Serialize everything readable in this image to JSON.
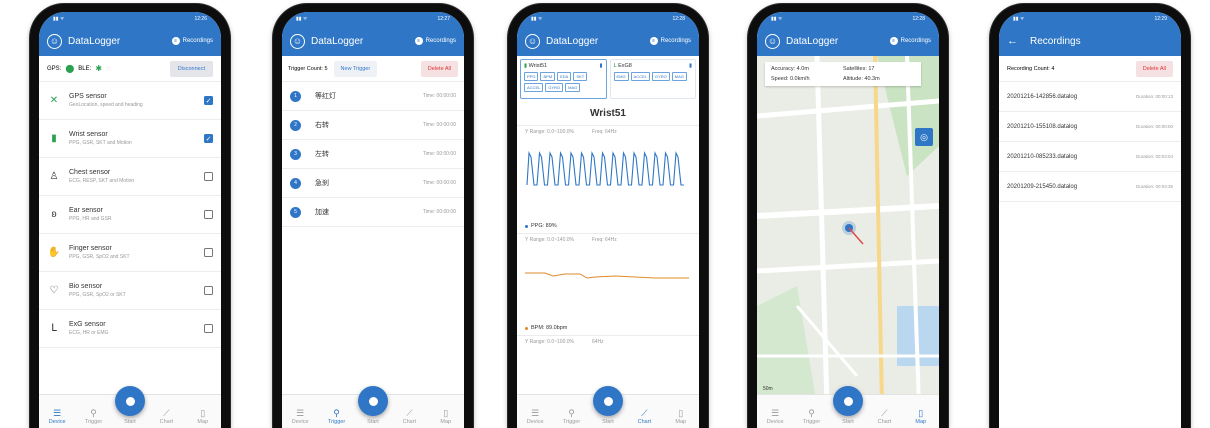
{
  "app": {
    "title": "DataLogger",
    "recordings_label": "Recordings"
  },
  "status": {
    "times": [
      "12:26",
      "12:27",
      "12:28",
      "12:28",
      "12:29"
    ]
  },
  "nav": {
    "device": "Device",
    "trigger": "Trigger",
    "start": "Start",
    "chart": "Chart",
    "map": "Map"
  },
  "device_screen": {
    "gps_label": "GPS:",
    "ble_label": "BLE:",
    "disconnect": "Disconnect",
    "sensors": [
      {
        "name": "GPS sensor",
        "desc": "GeoLocation, speed and heading",
        "checked": true,
        "icon": "satellite-icon"
      },
      {
        "name": "Wrist sensor",
        "desc": "PPG, GSR, SKT and Motion",
        "checked": true,
        "icon": "watch-icon"
      },
      {
        "name": "Chest sensor",
        "desc": "ECG, RESP, SKT and Motion",
        "checked": false,
        "icon": "chest-icon"
      },
      {
        "name": "Ear sensor",
        "desc": "PPG, HR and GSR",
        "checked": false,
        "icon": "ear-icon"
      },
      {
        "name": "Finger sensor",
        "desc": "PPG, GSR, SpO2 and SKT",
        "checked": false,
        "icon": "hand-icon"
      },
      {
        "name": "Bio sensor",
        "desc": "PPG, GSR, SpO2 or SKT",
        "checked": false,
        "icon": "heart-icon"
      },
      {
        "name": "ExG sensor",
        "desc": "ECG, HR or EMG",
        "checked": false,
        "icon": "muscle-icon"
      }
    ]
  },
  "trigger_screen": {
    "count_label": "Trigger Count: 5",
    "new_trigger": "New Trigger",
    "delete_all": "Delete All",
    "triggers": [
      {
        "num": "1",
        "name": "等红灯",
        "time": "Time: 00:00:00"
      },
      {
        "num": "2",
        "name": "右转",
        "time": "Time: 00:00:00"
      },
      {
        "num": "3",
        "name": "左转",
        "time": "Time: 00:00:00"
      },
      {
        "num": "4",
        "name": "急刹",
        "time": "Time: 00:00:00"
      },
      {
        "num": "5",
        "name": "加速",
        "time": "Time: 00:00:00"
      }
    ]
  },
  "chart_screen": {
    "devices": [
      {
        "name": "Wrist51",
        "chips": [
          "PPG",
          "BPM",
          "EDA",
          "SKT",
          "ACCEL",
          "GYRO",
          "MAG"
        ]
      },
      {
        "name": "ExG8",
        "chips": [
          "EMG",
          "ACCEL",
          "GYRO",
          "MAG"
        ]
      }
    ],
    "device_title": "Wrist51",
    "plot1": {
      "range": "Y Range:  0.0~100.0%",
      "freq": "Freq:  64Hz",
      "label": "PPG: 89%"
    },
    "plot2": {
      "range": "Y Range:  0.0~140.0%",
      "freq": "Freq:  64Hz",
      "label": "BPM: 89.0bpm"
    },
    "plot3": {
      "range": "Y Range:  0.0~100.0%",
      "freq": "64Hz"
    }
  },
  "map_screen": {
    "accuracy": "Accuracy: 4.0m",
    "satellites": "Satellites: 17",
    "speed": "Speed: 0.0km/h",
    "altitude": "Altitude: 40.3m",
    "scale": "50m"
  },
  "recordings_screen": {
    "title": "Recordings",
    "count_label": "Recording Count: 4",
    "delete_all": "Delete All",
    "items": [
      {
        "name": "20201216-142856.datalog",
        "duration": "Duration: 00:00:13"
      },
      {
        "name": "20201210-155108.datalog",
        "duration": "Duration: 00:00:00"
      },
      {
        "name": "20201210-085233.datalog",
        "duration": "Duration: 00:03:04"
      },
      {
        "name": "20201209-215450.datalog",
        "duration": "Duration: 00:03:35"
      }
    ]
  },
  "colors": {
    "primary": "#2f77c6",
    "danger": "#d33333",
    "orange": "#e08b2a",
    "green": "#2aa14f"
  }
}
